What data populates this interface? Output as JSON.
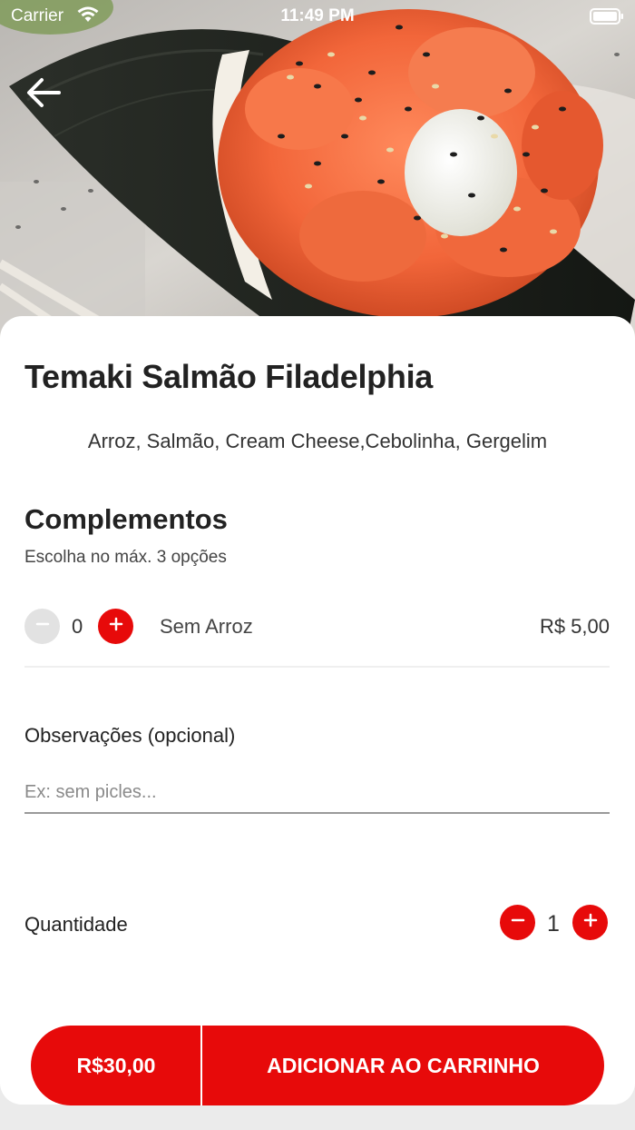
{
  "status_bar": {
    "carrier": "Carrier",
    "time": "11:49 PM"
  },
  "hero": {
    "image_subject": "temaki salmon hand roll",
    "back_icon": "arrow-left-icon"
  },
  "product": {
    "name": "Temaki Salmão Filadelphia",
    "description": "Arroz, Salmão, Cream Cheese,Cebolinha, Gergelim"
  },
  "complements": {
    "title": "Complementos",
    "subtitle": "Escolha no máx. 3 opções",
    "items": [
      {
        "count": "0",
        "name": "Sem Arroz",
        "price": "R$ 5,00"
      }
    ]
  },
  "notes": {
    "label": "Observações (opcional)",
    "placeholder": "Ex: sem picles...",
    "value": ""
  },
  "quantity": {
    "label": "Quantidade",
    "value": "1"
  },
  "cart": {
    "total": "R$30,00",
    "action_label": "ADICIONAR AO CARRINHO"
  },
  "colors": {
    "accent": "#e70a0a",
    "disabled": "#e2e2e2",
    "sheet_background": "#ffffff",
    "page_background": "#ebebeb"
  }
}
